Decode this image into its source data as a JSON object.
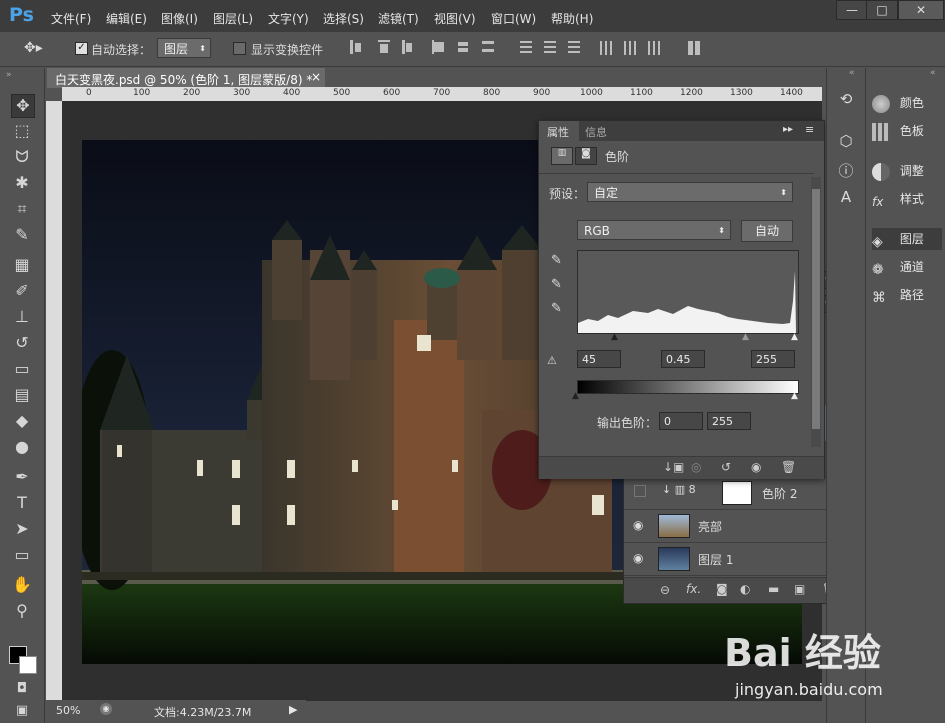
{
  "app": {
    "logo": "Ps"
  },
  "menu": [
    "文件(F)",
    "编辑(E)",
    "图像(I)",
    "图层(L)",
    "文字(Y)",
    "选择(S)",
    "滤镜(T)",
    "视图(V)",
    "窗口(W)",
    "帮助(H)"
  ],
  "window_controls": {
    "minimize": "—",
    "maximize": "□",
    "close": "✕"
  },
  "options": {
    "auto_select_label": "自动选择：",
    "auto_select_checked": true,
    "auto_select_target": "图层",
    "show_transform_label": "显示变换控件",
    "show_transform_checked": false
  },
  "document": {
    "tab_title": "白天变黑夜.psd @ 50% (色阶 1, 图层蒙版/8) *",
    "close": "×",
    "ruler_ticks": [
      "0",
      "100",
      "200",
      "300",
      "400",
      "500",
      "600",
      "700",
      "800",
      "900",
      "1000",
      "1100",
      "1200",
      "1300",
      "1400"
    ]
  },
  "status": {
    "zoom": "50%",
    "doc_info": "文档:4.23M/23.7M"
  },
  "properties": {
    "tabs": [
      "属性",
      "信息"
    ],
    "adjustment_title": "色阶",
    "preset_label": "预设：",
    "preset_value": "自定",
    "channel_value": "RGB",
    "auto_button": "自动",
    "input_black": "45",
    "input_gamma": "0.45",
    "input_white": "255",
    "output_label": "输出色阶：",
    "output_black": "0",
    "output_white": "255"
  },
  "layers": {
    "rows": [
      {
        "name": "色阶 2",
        "visible": false
      },
      {
        "name": "亮部",
        "visible": true
      },
      {
        "name": "图层 1",
        "visible": true
      }
    ],
    "partial_values": [
      "%",
      "%"
    ]
  },
  "dock": {
    "items": [
      {
        "label": "颜色",
        "icon": "palette-icon"
      },
      {
        "label": "色板",
        "icon": "swatches-icon"
      },
      {
        "label": "调整",
        "icon": "adjust-icon"
      },
      {
        "label": "样式",
        "icon": "fx-icon"
      },
      {
        "label": "图层",
        "icon": "layers-icon"
      },
      {
        "label": "通道",
        "icon": "channels-icon"
      },
      {
        "label": "路径",
        "icon": "paths-icon"
      }
    ]
  },
  "watermark": {
    "brand": "Bai 经验",
    "url": "jingyan.baidu.com"
  },
  "colors": {
    "accent": "#4aa3e8",
    "panel": "#535353",
    "menubar": "#3c3c3c"
  }
}
